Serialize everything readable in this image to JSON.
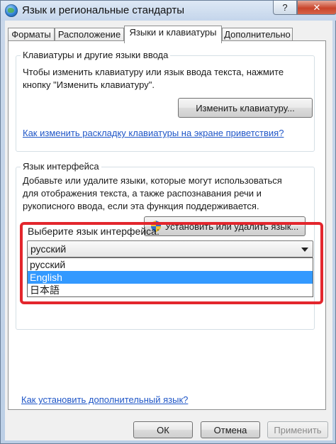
{
  "window": {
    "title": "Язык и региональные стандарты",
    "help_label": "?",
    "close_label": "✕"
  },
  "tabs": [
    {
      "label": "Форматы"
    },
    {
      "label": "Расположение"
    },
    {
      "label": "Языки и клавиатуры"
    },
    {
      "label": "Дополнительно"
    }
  ],
  "keyboards_group": {
    "title": "Клавиатуры и другие языки ввода",
    "line1": "Чтобы изменить клавиатуру или язык ввода текста, нажмите",
    "line2": "кнопку \"Изменить клавиатуру\".",
    "change_button": "Изменить клавиатуру...",
    "welcome_link": "Как изменить раскладку клавиатуры на экране приветствия?"
  },
  "display_language_group": {
    "title": "Язык интерфейса",
    "line1": "Добавьте или удалите языки, которые могут использоваться",
    "line2": "для отображения текста, а также распознавания речи и",
    "line3": "рукописного ввода, если эта функция поддерживается.",
    "install_button": "Установить или удалить язык...",
    "choose_label": "Выберите язык интерфейса:",
    "selected_value": "русский",
    "options": [
      "русский",
      "English",
      "日本語"
    ],
    "highlighted_option": "English"
  },
  "more_languages_link": "Как установить дополнительный язык?",
  "footer": {
    "ok": "ОК",
    "cancel": "Отмена",
    "apply": "Применить"
  },
  "colors": {
    "highlight_border": "#e3262d",
    "selection": "#3399ff",
    "link": "#1f56c7"
  }
}
